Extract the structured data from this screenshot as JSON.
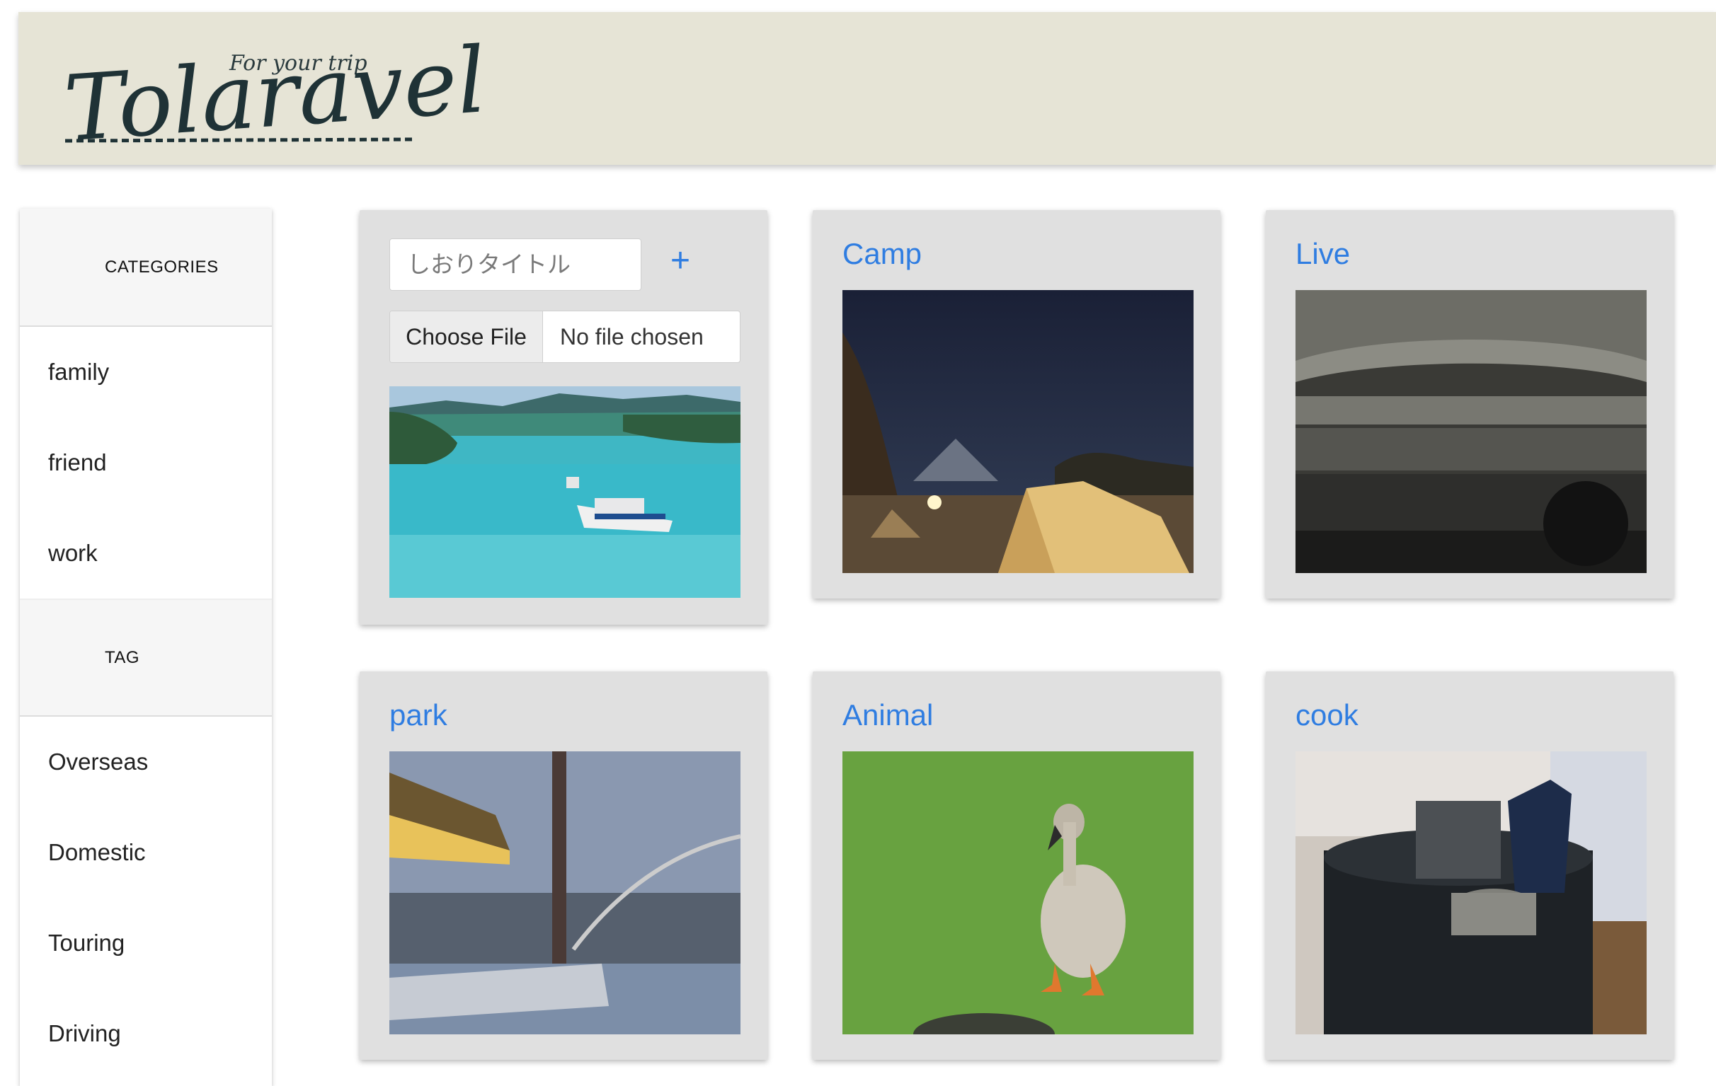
{
  "header": {
    "logo_tagline": "For your trip",
    "logo_main": "Tolaravel"
  },
  "sidebar": {
    "categories_heading": "CATEGORIES",
    "categories": [
      "family",
      "friend",
      "work"
    ],
    "tag_heading": "TAG",
    "tags": [
      "Overseas",
      "Domestic",
      "Touring",
      "Driving"
    ]
  },
  "add_card": {
    "title_placeholder": "しおりタイトル",
    "add_icon": "plus-icon",
    "file_button_label": "Choose File",
    "file_status": "No file chosen"
  },
  "cards": [
    {
      "title": "Camp"
    },
    {
      "title": "Live"
    },
    {
      "title": "park"
    },
    {
      "title": "Animal"
    },
    {
      "title": "cook"
    }
  ],
  "colors": {
    "header_bg": "#e6e4d6",
    "card_bg": "#e0e0e0",
    "accent": "#2f7de1"
  }
}
